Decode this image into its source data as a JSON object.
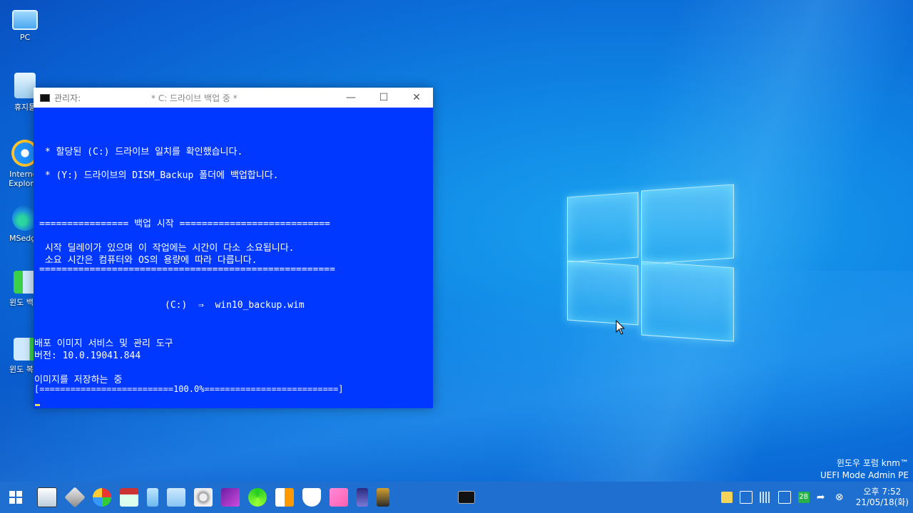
{
  "desktop": {
    "icons": [
      {
        "label": "PC",
        "icon": "computer-icon"
      },
      {
        "label": "휴지통",
        "icon": "recycle-bin-icon"
      },
      {
        "label": "Internet Explorer",
        "icon": "internet-explorer-icon"
      },
      {
        "label": "MSedge",
        "icon": "edge-icon"
      },
      {
        "label": "윈도 백업",
        "icon": "windows-backup-icon"
      },
      {
        "label": "윈도 복원",
        "icon": "windows-restore-icon"
      }
    ]
  },
  "window": {
    "admin_label": "관리자:",
    "title": "* C: 드라이브 백업 중 *",
    "minimize": "—",
    "maximize": "☐",
    "close": "✕"
  },
  "console": {
    "line1": " * 할당된 (C:) 드라이브 일치를 확인했습니다.",
    "line2": " * (Y:) 드라이브의 DISM_Backup 폴더에 백업합니다.",
    "line3": "================ 백업 시작 ===========================",
    "line4": " 시작 딜레이가 있으며 이 작업에는 시간이 다소 소요됩니다.",
    "line5": " 소요 시간은 컴퓨터와 OS의 용량에 따라 다릅니다.",
    "line6": "=====================================================",
    "line7": "(C:)  ⇒  win10_backup.wim",
    "line8": "배포 이미지 서비스 및 관리 도구",
    "line9": "버전: 10.0.19041.844",
    "line10": "이미지를 저장하는 중",
    "progress_line": "[==========================100.0%==========================]",
    "progress_percent": 100.0
  },
  "watermark": {
    "line1": "윈도우 포럼 knm™",
    "line2": "UEFI Mode Admin PE"
  },
  "taskbar": {
    "pinned": [
      "system-monitor-icon",
      "disk-tool-icon",
      "partition-icon",
      "network-icon",
      "drive-icon",
      "notepad-icon",
      "explorer-icon",
      "tools-icon",
      "media-icon",
      "refresh-icon",
      "registry-icon",
      "shield-icon",
      "metro-icon",
      "phone-icon",
      "sd-card-icon"
    ],
    "active_app": "cmd-icon",
    "tray": {
      "badge_number": "28",
      "time": "오후 7:52",
      "date": "21/05/18(화)"
    }
  },
  "colors": {
    "console_bg": "#0038ff",
    "taskbar_bg": "#1f6fd0"
  }
}
